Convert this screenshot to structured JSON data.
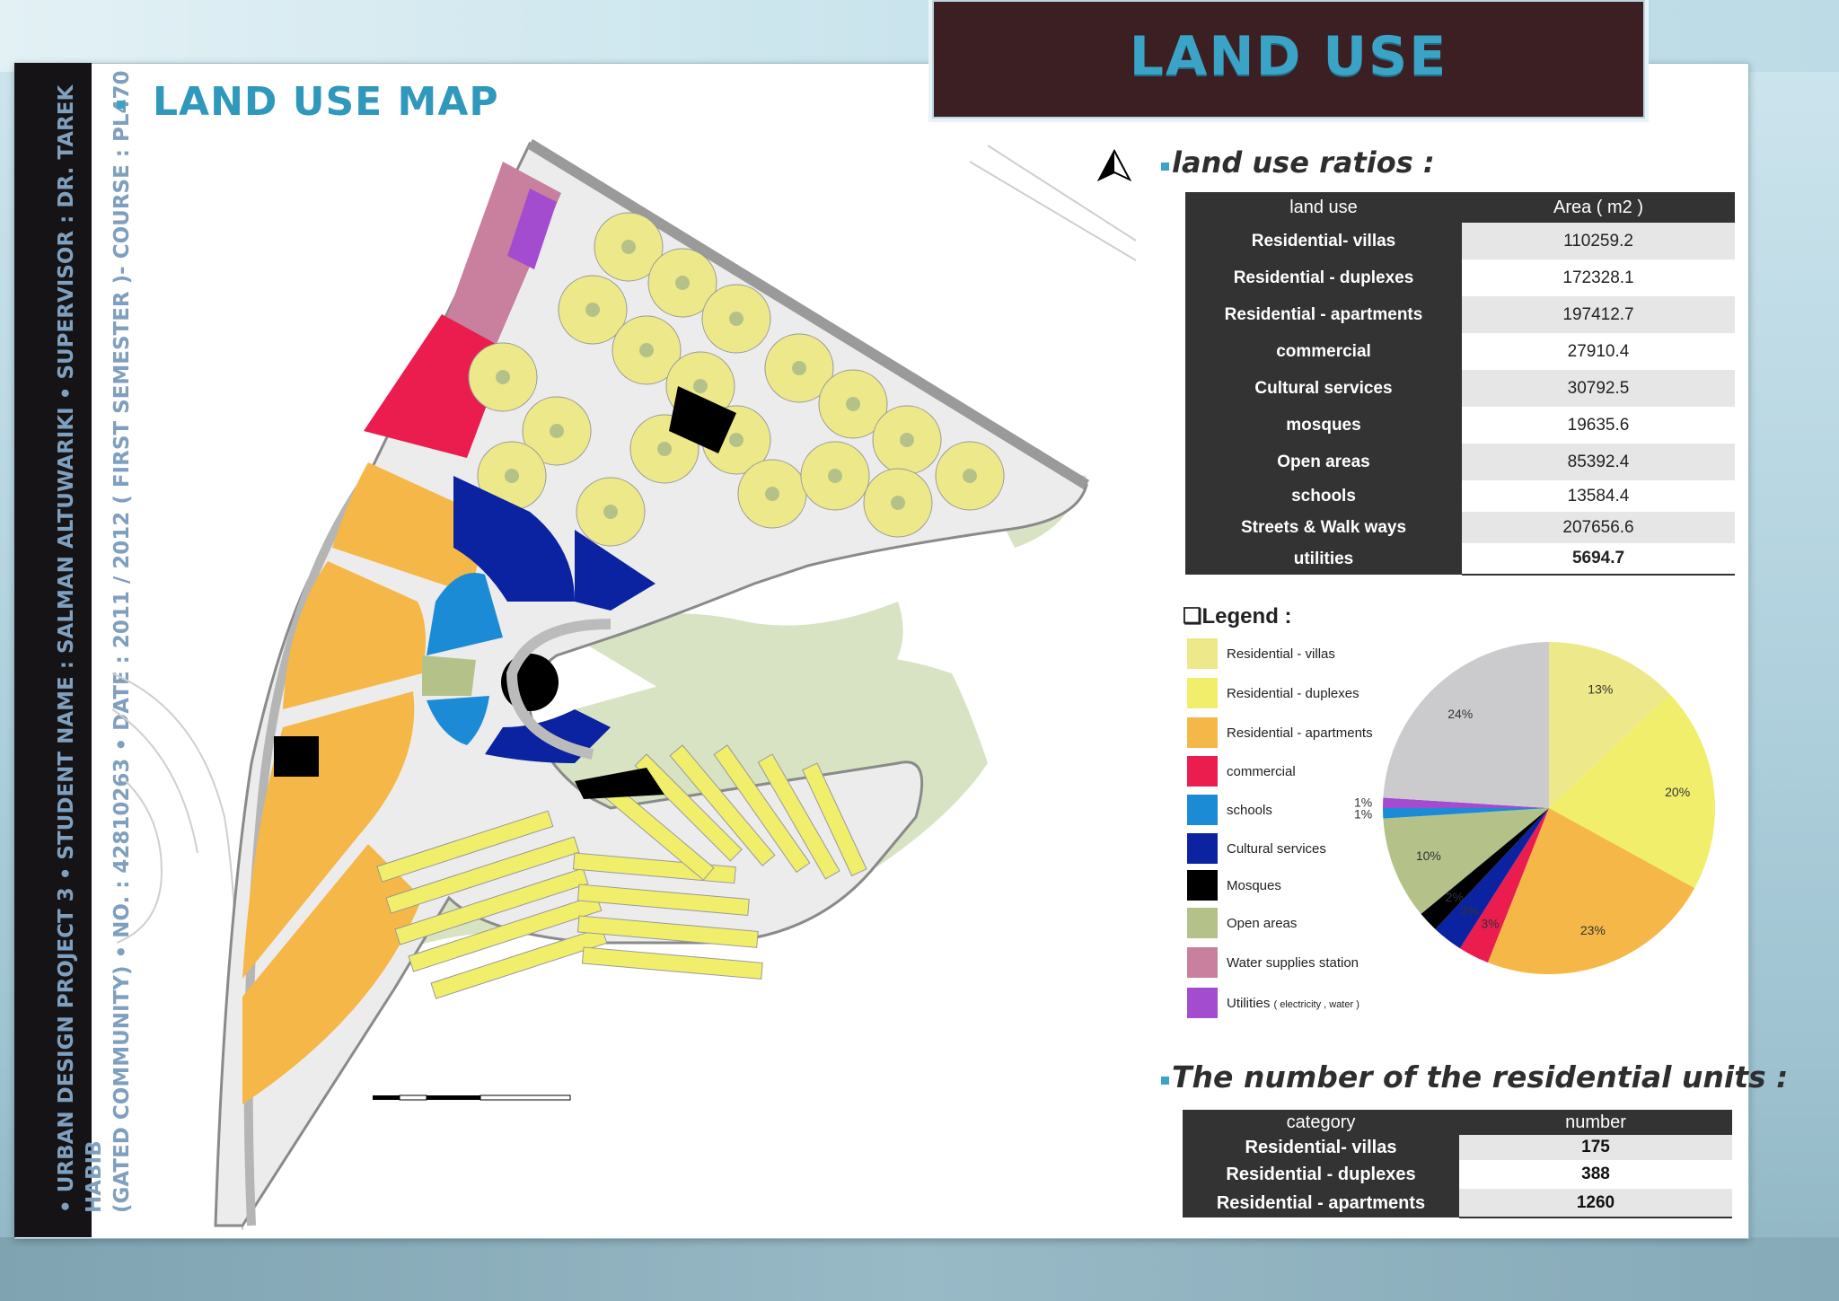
{
  "banner": {
    "title": "LAND USE"
  },
  "sidebar": {
    "line1": "•  URBAN DESIGN PROJECT 3   •  STUDENT NAME : SALMAN ALTUWARIKI   •  SUPERVISOR : DR. TAREK HABIB",
    "line2": "(GATED COMMUNITY)   •  NO. : 42810263   •  DATE : 2011 / 2012 ( FIRST SEMESTER )- COURSE : PL470"
  },
  "map": {
    "title": "LAND USE MAP"
  },
  "ratios": {
    "title": "land use ratios :",
    "headers": [
      "land use",
      "Area  ( m2 )"
    ],
    "rows": [
      {
        "label": "Residential- villas",
        "value": "110259.2"
      },
      {
        "label": "Residential - duplexes",
        "value": "172328.1"
      },
      {
        "label": "Residential - apartments",
        "value": "197412.7"
      },
      {
        "label": "commercial",
        "value": "27910.4"
      },
      {
        "label": "Cultural services",
        "value": "30792.5"
      },
      {
        "label": "mosques",
        "value": "19635.6"
      },
      {
        "label": "Open areas",
        "value": "85392.4"
      },
      {
        "label": "schools",
        "value": "13584.4"
      },
      {
        "label": "Streets & Walk ways",
        "value": "207656.6"
      },
      {
        "label": "utilities",
        "value": "5694.7"
      }
    ]
  },
  "legend": {
    "title": "Legend :",
    "items": [
      {
        "label": "Residential - villas",
        "color": "#ede88a"
      },
      {
        "label": "Residential - duplexes",
        "color": "#f1ee6c"
      },
      {
        "label": "Residential - apartments",
        "color": "#f5b748"
      },
      {
        "label": "commercial",
        "color": "#ea1d4e"
      },
      {
        "label": "schools",
        "color": "#1c8bd6"
      },
      {
        "label": "Cultural services",
        "color": "#0b23a0"
      },
      {
        "label": "Mosques",
        "color": "#000000"
      },
      {
        "label": "Open areas",
        "color": "#b4c28a"
      },
      {
        "label": "Water supplies station",
        "color": "#c8809e"
      },
      {
        "label": "Utilities",
        "small": "( electricity , water )",
        "color": "#a34ccf"
      }
    ]
  },
  "chart_data": {
    "type": "pie",
    "slices": [
      {
        "name": "Residential - villas",
        "value": 13,
        "label": "13%",
        "color": "#ede88a"
      },
      {
        "name": "Residential - duplexes",
        "value": 20,
        "label": "20%",
        "color": "#f1ee6c"
      },
      {
        "name": "Residential - apartments",
        "value": 23,
        "label": "23%",
        "color": "#f5b748"
      },
      {
        "name": "commercial",
        "value": 3,
        "label": "3%",
        "color": "#ea1d4e"
      },
      {
        "name": "Cultural services",
        "value": 3,
        "label": "3%",
        "color": "#0b23a0"
      },
      {
        "name": "Mosques",
        "value": 2,
        "label": "2%",
        "color": "#000000"
      },
      {
        "name": "Open areas",
        "value": 10,
        "label": "10%",
        "color": "#b4c28a"
      },
      {
        "name": "schools",
        "value": 1,
        "label": "1%",
        "color": "#1c8bd6"
      },
      {
        "name": "Utilities",
        "value": 1,
        "label": "1%",
        "color": "#a34ccf"
      },
      {
        "name": "Streets & Walk ways",
        "value": 24,
        "label": "24%",
        "color": "#cbcbce"
      }
    ]
  },
  "units": {
    "title": "The number of the residential units :",
    "headers": [
      "category",
      "number"
    ],
    "rows": [
      {
        "label": "Residential- villas",
        "value": "175"
      },
      {
        "label": "Residential - duplexes",
        "value": "388"
      },
      {
        "label": "Residential - apartments",
        "value": "1260"
      }
    ]
  }
}
